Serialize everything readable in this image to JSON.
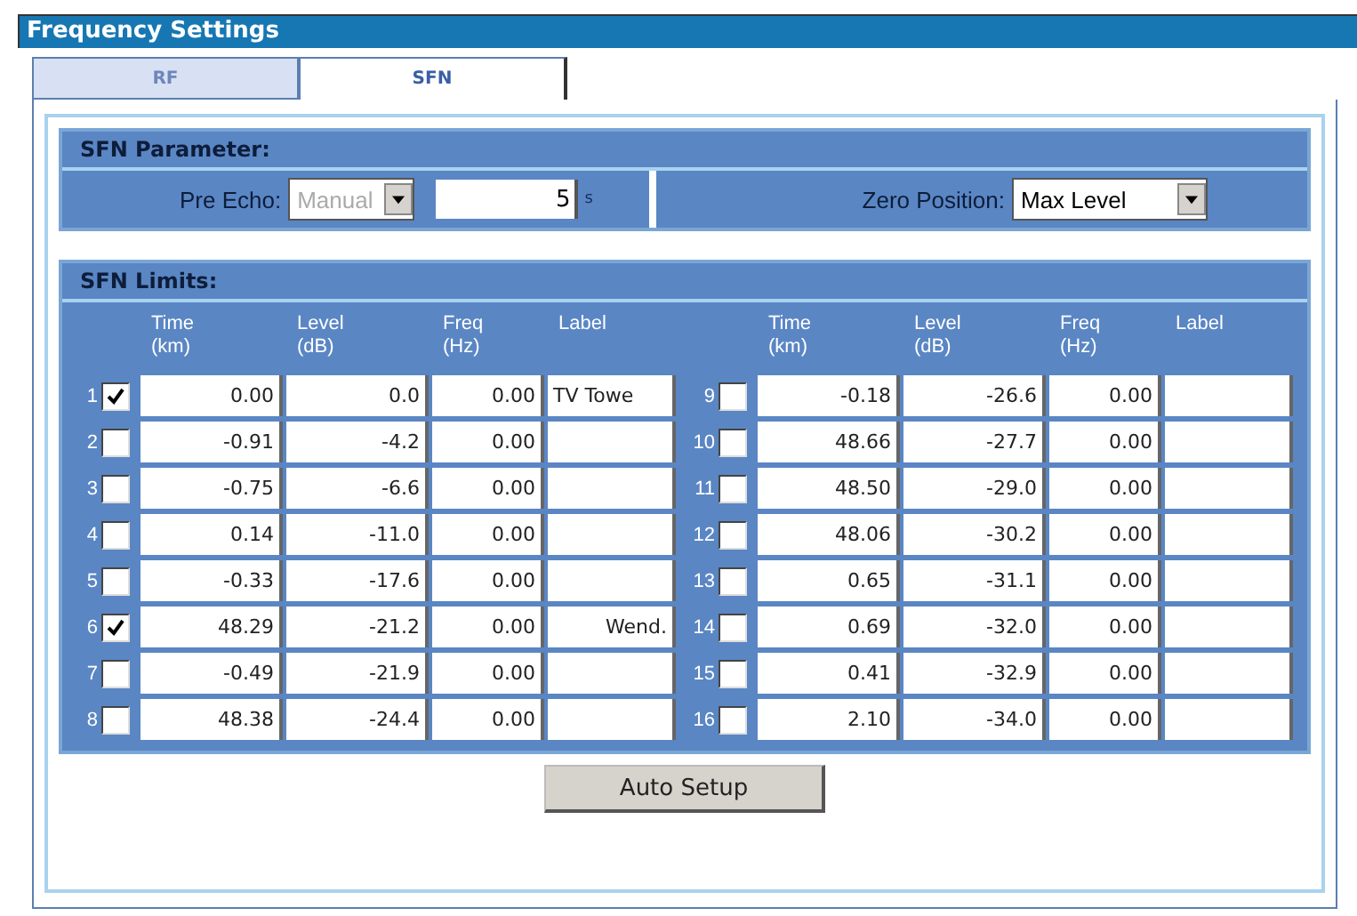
{
  "window": {
    "title": "Frequency Settings"
  },
  "tabs": [
    {
      "label": "RF",
      "selected": false
    },
    {
      "label": "SFN",
      "selected": true
    }
  ],
  "sfn_parameter": {
    "title": "SFN Parameter:",
    "pre_echo": {
      "label": "Pre Echo:",
      "mode": "Manual",
      "mode_disabled": true,
      "value": "5",
      "unit": "s"
    },
    "zero_position": {
      "label": "Zero Position:",
      "value": "Max Level"
    }
  },
  "sfn_limits": {
    "title": "SFN Limits:",
    "halves": [
      {
        "columns": [
          {
            "top": "Time",
            "bottom": "(km)"
          },
          {
            "top": "Level",
            "bottom": "(dB)"
          },
          {
            "top": "Freq",
            "bottom": "(Hz)"
          },
          {
            "top": "Label"
          }
        ],
        "rows": [
          {
            "number": "1",
            "checked": true,
            "time": "0.00",
            "level": "0.0",
            "freq": "0.00",
            "label": "TV Towe"
          },
          {
            "number": "2",
            "checked": false,
            "time": "-0.91",
            "level": "-4.2",
            "freq": "0.00"
          },
          {
            "number": "3",
            "checked": false,
            "time": "-0.75",
            "level": "-6.6",
            "freq": "0.00"
          },
          {
            "number": "4",
            "checked": false,
            "time": "0.14",
            "level": "-11.0",
            "freq": "0.00"
          },
          {
            "number": "5",
            "checked": false,
            "time": "-0.33",
            "level": "-17.6",
            "freq": "0.00"
          },
          {
            "number": "6",
            "checked": true,
            "time": "48.29",
            "level": "-21.2",
            "freq": "0.00",
            "label": "Wend."
          },
          {
            "number": "7",
            "checked": false,
            "time": "-0.49",
            "level": "-21.9",
            "freq": "0.00"
          },
          {
            "number": "8",
            "checked": false,
            "time": "48.38",
            "level": "-24.4",
            "freq": "0.00"
          }
        ]
      },
      {
        "columns": [
          {
            "top": "Time",
            "bottom": "(km)"
          },
          {
            "top": "Level",
            "bottom": "(dB)"
          },
          {
            "top": "Freq",
            "bottom": "(Hz)"
          },
          {
            "top": "Label"
          }
        ],
        "rows": [
          {
            "number": "9",
            "checked": false,
            "time": "-0.18",
            "level": "-26.6",
            "freq": "0.00"
          },
          {
            "number": "10",
            "checked": false,
            "time": "48.66",
            "level": "-27.7",
            "freq": "0.00"
          },
          {
            "number": "11",
            "checked": false,
            "time": "48.50",
            "level": "-29.0",
            "freq": "0.00"
          },
          {
            "number": "12",
            "checked": false,
            "time": "48.06",
            "level": "-30.2",
            "freq": "0.00"
          },
          {
            "number": "13",
            "checked": false,
            "time": "0.65",
            "level": "-31.1",
            "freq": "0.00"
          },
          {
            "number": "14",
            "checked": false,
            "time": "0.69",
            "level": "-32.0",
            "freq": "0.00"
          },
          {
            "number": "15",
            "checked": false,
            "time": "0.41",
            "level": "-32.9",
            "freq": "0.00"
          },
          {
            "number": "16",
            "checked": false,
            "time": "2.10",
            "level": "-34.0",
            "freq": "0.00"
          }
        ]
      }
    ]
  },
  "buttons": [
    "Auto Setup"
  ]
}
